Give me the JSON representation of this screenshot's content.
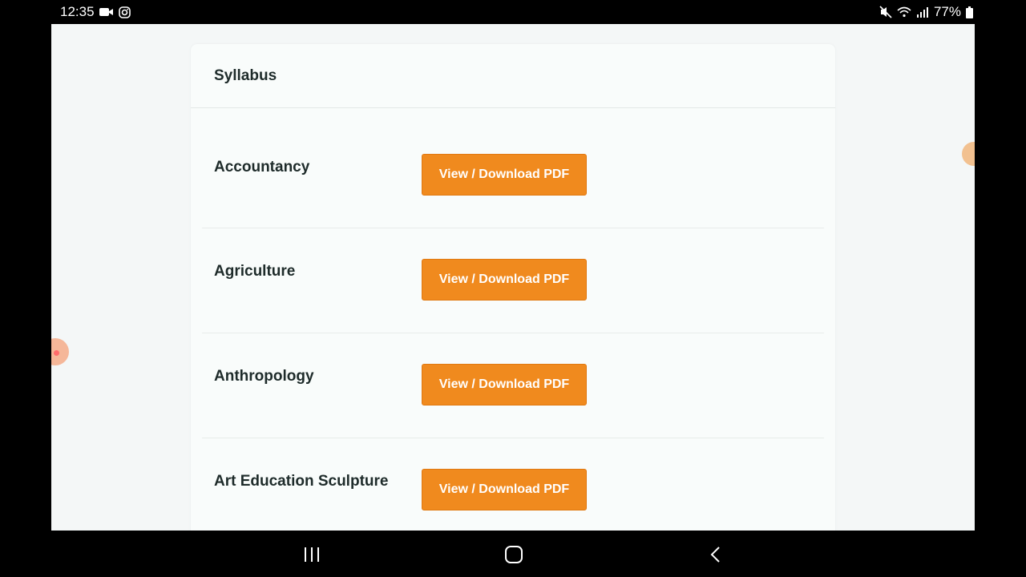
{
  "status_bar": {
    "time": "12:35",
    "battery": "77%",
    "left_icons": [
      "video-camera-icon",
      "instagram-icon"
    ],
    "right_icons": [
      "mute-icon",
      "wifi-icon",
      "signal-icon",
      "battery-icon"
    ]
  },
  "page": {
    "title": "Syllabus",
    "button_color": "#f08a1e",
    "subjects": [
      {
        "name": "Accountancy",
        "button": "View / Download PDF"
      },
      {
        "name": "Agriculture",
        "button": "View / Download PDF"
      },
      {
        "name": "Anthropology",
        "button": "View / Download PDF"
      },
      {
        "name": "Art Education Sculpture",
        "button": "View / Download PDF"
      }
    ]
  },
  "nav_bar": {
    "buttons": [
      "recent-apps-icon",
      "home-icon",
      "back-icon"
    ]
  }
}
